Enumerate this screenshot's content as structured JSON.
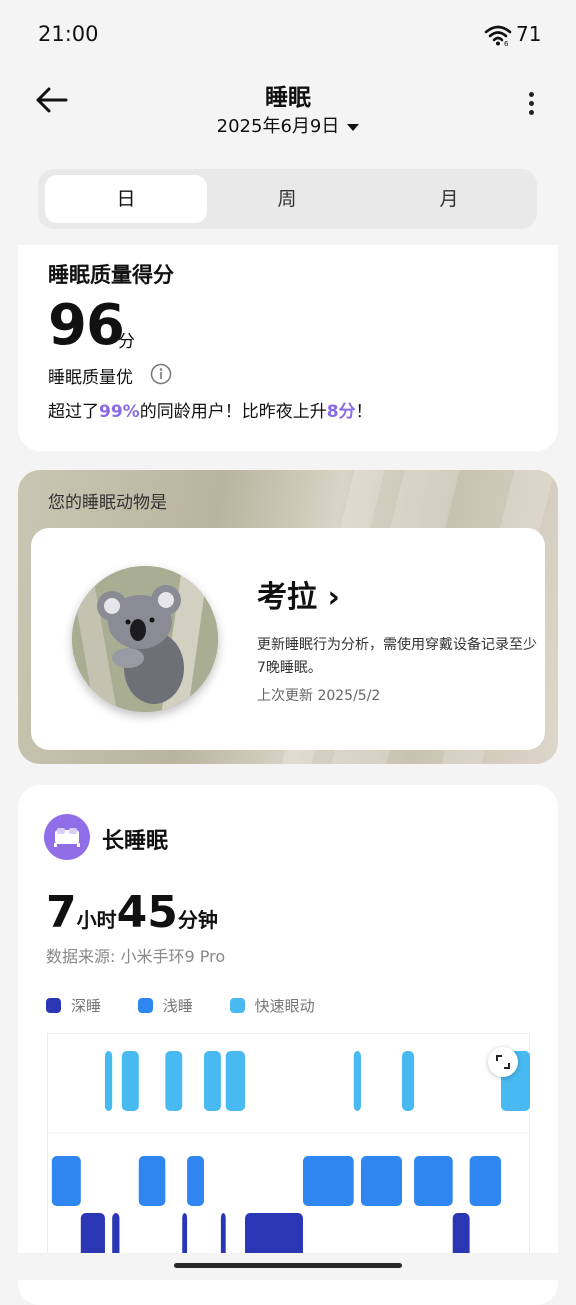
{
  "status": {
    "time": "21:00",
    "battery": "71"
  },
  "header": {
    "title": "睡眠",
    "date": "2025年6月9日"
  },
  "tabs": [
    {
      "label": "日",
      "active": true
    },
    {
      "label": "周",
      "active": false
    },
    {
      "label": "月",
      "active": false
    }
  ],
  "score_card": {
    "title": "睡眠质量得分",
    "score": "96",
    "unit": "分",
    "quality": "睡眠质量优",
    "compare_prefix": "超过了",
    "compare_percent": "99%",
    "compare_middle": "的同龄用户！比昨夜上升",
    "compare_delta": "8分",
    "compare_suffix": "！",
    "highlight_color": "#8a6be6"
  },
  "animal_card": {
    "title": "您的睡眠动物是",
    "animal_name": "考拉",
    "chevron": "›",
    "description": "更新睡眠行为分析，需使用穿戴设备记录至少7晚睡眠。",
    "last_update": "上次更新 2025/5/2"
  },
  "sleep_card": {
    "title": "长睡眠",
    "hours": "7",
    "hours_unit": "小时",
    "minutes": "45",
    "minutes_unit": "分钟",
    "source": "数据来源: 小米手环9 Pro",
    "icon": "bed-icon",
    "legend": [
      {
        "label": "深睡",
        "color": "#2a36b3"
      },
      {
        "label": "浅睡",
        "color": "#2f86f0"
      },
      {
        "label": "快速眼动",
        "color": "#48b9f1"
      }
    ]
  },
  "chart_data": {
    "type": "bar",
    "description_levels": [
      "快速眼动",
      "浅睡",
      "深睡"
    ],
    "stages": [
      {
        "stage": "浅睡",
        "start": 0.01,
        "end": 0.07
      },
      {
        "stage": "深睡",
        "start": 0.07,
        "end": 0.12
      },
      {
        "stage": "快速眼动",
        "start": 0.12,
        "end": 0.135
      },
      {
        "stage": "深睡",
        "start": 0.135,
        "end": 0.15
      },
      {
        "stage": "快速眼动",
        "start": 0.155,
        "end": 0.19
      },
      {
        "stage": "浅睡",
        "start": 0.19,
        "end": 0.245
      },
      {
        "stage": "快速眼动",
        "start": 0.245,
        "end": 0.28
      },
      {
        "stage": "深睡",
        "start": 0.28,
        "end": 0.29
      },
      {
        "stage": "浅睡",
        "start": 0.29,
        "end": 0.325
      },
      {
        "stage": "快速眼动",
        "start": 0.325,
        "end": 0.36
      },
      {
        "stage": "深睡",
        "start": 0.36,
        "end": 0.37
      },
      {
        "stage": "快速眼动",
        "start": 0.37,
        "end": 0.41
      },
      {
        "stage": "深睡",
        "start": 0.41,
        "end": 0.53
      },
      {
        "stage": "浅睡",
        "start": 0.53,
        "end": 0.635
      },
      {
        "stage": "快速眼动",
        "start": 0.635,
        "end": 0.65
      },
      {
        "stage": "浅睡",
        "start": 0.65,
        "end": 0.735
      },
      {
        "stage": "快速眼动",
        "start": 0.735,
        "end": 0.76
      },
      {
        "stage": "浅睡",
        "start": 0.76,
        "end": 0.84
      },
      {
        "stage": "深睡",
        "start": 0.84,
        "end": 0.875
      },
      {
        "stage": "浅睡",
        "start": 0.875,
        "end": 0.94
      },
      {
        "stage": "快速眼动",
        "start": 0.94,
        "end": 1.0
      }
    ]
  }
}
